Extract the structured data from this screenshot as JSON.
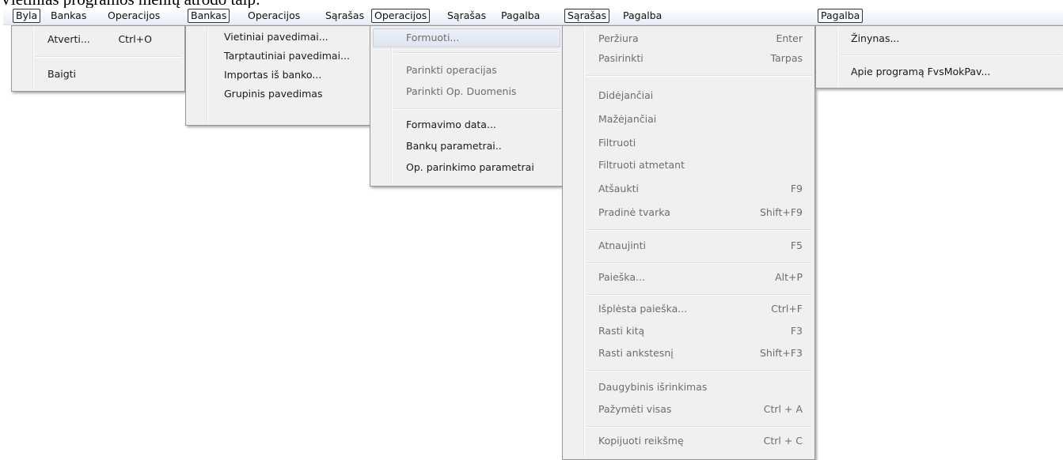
{
  "caption": "Vietinias programos menių atrodo taip:",
  "byla": {
    "bar": [
      "Byla",
      "Bankas",
      "Operacijos"
    ],
    "items": [
      {
        "label": "Atverti...",
        "shortcut": "Ctrl+O"
      },
      {
        "label": "Baigti",
        "shortcut": ""
      }
    ]
  },
  "bankas": {
    "bar": [
      "Bankas",
      "Operacijos",
      "Sąrašas"
    ],
    "items": [
      {
        "label": "Vietiniai pavedimai..."
      },
      {
        "label": "Tarptautiniai pavedimai..."
      },
      {
        "label": "Importas iš banko..."
      },
      {
        "label": "Grupinis pavedimas"
      }
    ]
  },
  "operacijos": {
    "bar": [
      "Operacijos",
      "Sąrašas",
      "Pagalba"
    ],
    "items": [
      {
        "label": "Formuoti..."
      },
      {
        "label": "Parinkti operacijas"
      },
      {
        "label": "Parinkti Op. Duomenis"
      },
      {
        "label": "Formavimo data..."
      },
      {
        "label": "Bankų parametrai.."
      },
      {
        "label": "Op. parinkimo parametrai"
      }
    ]
  },
  "sarasas": {
    "bar": [
      "Sąrašas",
      "Pagalba"
    ],
    "items": [
      {
        "label": "Peržiura",
        "shortcut": "Enter"
      },
      {
        "label": "Pasirinkti",
        "shortcut": "Tarpas"
      },
      {
        "label": "Didėjančiai",
        "shortcut": ""
      },
      {
        "label": "Mažėjančiai",
        "shortcut": ""
      },
      {
        "label": "Filtruoti",
        "shortcut": ""
      },
      {
        "label": "Filtruoti atmetant",
        "shortcut": ""
      },
      {
        "label": "Atšaukti",
        "shortcut": "F9"
      },
      {
        "label": "Pradinė tvarka",
        "shortcut": "Shift+F9"
      },
      {
        "label": "Atnaujinti",
        "shortcut": "F5"
      },
      {
        "label": "Paieška...",
        "shortcut": "Alt+P"
      },
      {
        "label": "Išplėsta paieška...",
        "shortcut": "Ctrl+F"
      },
      {
        "label": "Rasti kitą",
        "shortcut": "F3"
      },
      {
        "label": "Rasti ankstesnį",
        "shortcut": "Shift+F3"
      },
      {
        "label": "Daugybinis išrinkimas",
        "shortcut": ""
      },
      {
        "label": "Pažymėti visas",
        "shortcut": "Ctrl + A"
      },
      {
        "label": "Kopijuoti reikšmę",
        "shortcut": "Ctrl + C"
      }
    ]
  },
  "pagalba": {
    "bar": [
      "Pagalba"
    ],
    "items": [
      {
        "label": "Žinynas..."
      },
      {
        "label": "Apie programą FvsMokPav..."
      }
    ]
  }
}
